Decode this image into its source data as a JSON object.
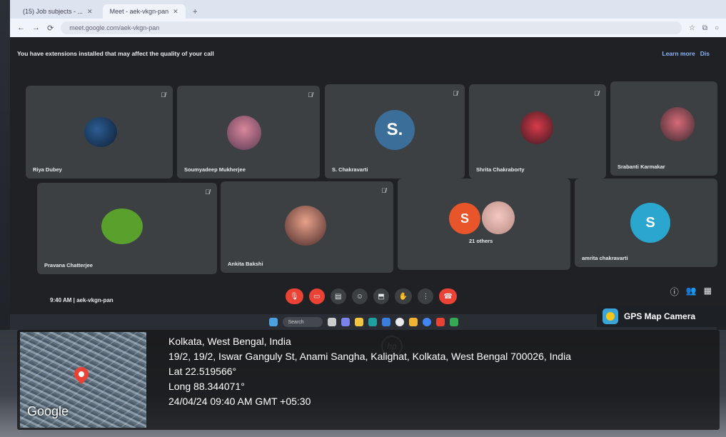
{
  "browser": {
    "tabs": [
      {
        "label": "(15) Job subjects - ...",
        "active": false
      },
      {
        "label": "Meet - aek-vkgn-pan",
        "active": true
      }
    ],
    "url": "meet.google.com/aek-vkgn-pan"
  },
  "banner": {
    "message": "You have extensions installed that may affect the quality of your call",
    "learn_more": "Learn more",
    "dismiss": "Dis"
  },
  "participants": [
    {
      "name": "Riya Dubey"
    },
    {
      "name": "Soumyadeep Mukherjee"
    },
    {
      "name": "S. Chakravarti",
      "initial": "S."
    },
    {
      "name": "Shrita Chakraborty"
    },
    {
      "name": "Srabanti Karmakar"
    },
    {
      "name": "Pravana Chatterjee"
    },
    {
      "name": "Ankita Bakshi"
    },
    {
      "name": "21 others",
      "initial": "S"
    },
    {
      "name": "amrita chakravarti",
      "initial": "S"
    }
  ],
  "meeting": {
    "time": "9:40 AM",
    "separator": "|",
    "code": "aek-vkgn-pan"
  },
  "taskbar": {
    "search": "Search"
  },
  "gps": {
    "app_name": "GPS Map Camera",
    "city": "Kolkata, West Bengal, India",
    "address": "19/2, 19/2, Iswar Ganguly St, Anami Sangha, Kalighat, Kolkata, West Bengal 700026, India",
    "lat": "Lat 22.519566°",
    "long": "Long 88.344071°",
    "datetime": "24/04/24 09:40 AM GMT +05:30",
    "map_brand": "Google"
  },
  "colors": {
    "accent_red": "#ea4335",
    "tile_bg": "#3c4043",
    "avatar_blue": "#3b6e98",
    "avatar_teal": "#2aa6cf",
    "avatar_orange": "#e8552b"
  }
}
